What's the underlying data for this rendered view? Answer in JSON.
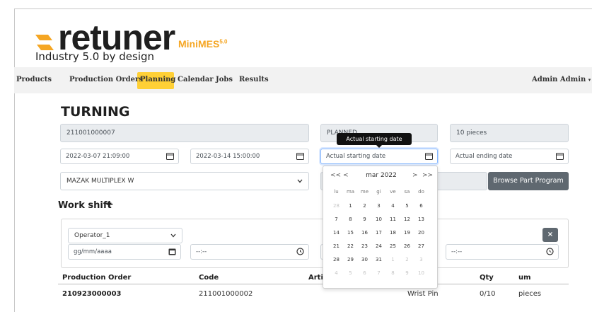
{
  "brand": {
    "name": "retuner",
    "product": "MiniMES",
    "product_version": "5.0",
    "tagline": "Industry 5.0 by design",
    "accent_color": "#f5a623"
  },
  "nav": {
    "items": [
      "Products",
      "Production Orders",
      "Planning",
      "Calendar",
      "Jobs",
      "Results"
    ],
    "active": "Planning",
    "active_color": "#ffd036",
    "user": "Admin Admin"
  },
  "page": {
    "title": "TURNING",
    "code": "211001000007",
    "status": "PLANNED",
    "quantity": "10 pieces",
    "planned_start": "2022-03-07 21:09:00",
    "planned_end": "2022-03-14 15:00:00",
    "actual_start_placeholder": "Actual starting date",
    "actual_end_placeholder": "Actual ending date",
    "machine": "MAZAK MULTIPLEX W",
    "browse_label": "Browse Part Program"
  },
  "tooltip": "Actual starting date",
  "work_shift": {
    "label": "Work shift",
    "add_label": "+",
    "operator": "Operator_1",
    "date_placeholder": "gg/mm/aaaa",
    "time_placeholder": "--:--",
    "remove_label": "×"
  },
  "table": {
    "headers": [
      "Production Order",
      "Code",
      "Arti",
      "Qty",
      "um"
    ],
    "row": {
      "production_order": "210923000003",
      "code": "211001000002",
      "article": "Wrist Pin",
      "qty": "0/10",
      "um": "pieces"
    }
  },
  "datepicker": {
    "nav_prev_year": "<<",
    "nav_prev": "<",
    "month_year": "mar 2022",
    "nav_next": ">",
    "nav_next_year": ">>",
    "weekdays": [
      "lu",
      "ma",
      "me",
      "gi",
      "ve",
      "sa",
      "do"
    ],
    "weeks": [
      [
        "28",
        "1",
        "2",
        "3",
        "4",
        "5",
        "6"
      ],
      [
        "7",
        "8",
        "9",
        "10",
        "11",
        "12",
        "13"
      ],
      [
        "14",
        "15",
        "16",
        "17",
        "18",
        "19",
        "20"
      ],
      [
        "21",
        "22",
        "23",
        "24",
        "25",
        "26",
        "27"
      ],
      [
        "28",
        "29",
        "30",
        "31",
        "1",
        "2",
        "3"
      ],
      [
        "4",
        "5",
        "6",
        "7",
        "8",
        "9",
        "10"
      ]
    ]
  }
}
